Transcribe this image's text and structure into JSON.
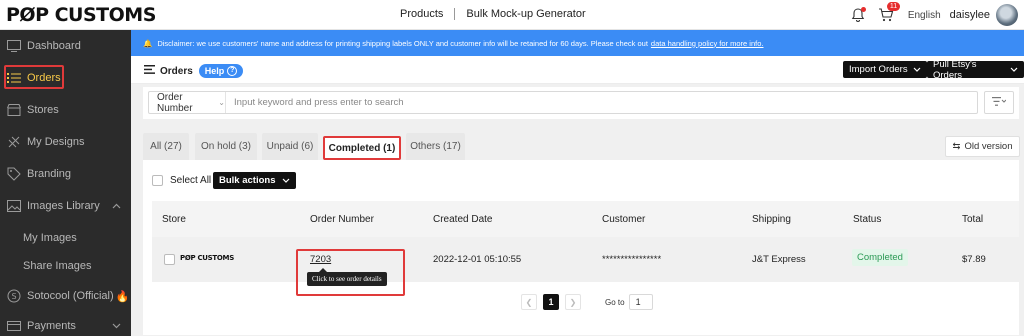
{
  "header": {
    "logo": "PØP CUSTOMS",
    "nav": [
      "Products",
      "Bulk Mock-up Generator"
    ],
    "cart_count": "11",
    "language": "English",
    "username": "daisylee"
  },
  "sidebar": {
    "items": [
      {
        "label": "Dashboard",
        "icon": "dashboard-icon"
      },
      {
        "label": "Orders",
        "icon": "orders-list-icon",
        "active": true
      },
      {
        "label": "Stores",
        "icon": "store-icon"
      },
      {
        "label": "My Designs",
        "icon": "design-icon"
      },
      {
        "label": "Branding",
        "icon": "tag-icon"
      },
      {
        "label": "Images Library",
        "icon": "image-icon"
      },
      {
        "label": "My Images"
      },
      {
        "label": "Share Images"
      },
      {
        "label": "Sotocool (Official)",
        "icon": "coin-icon"
      },
      {
        "label": "Payments",
        "icon": "payment-icon"
      }
    ]
  },
  "banner": {
    "text": "Disclaimer: we use customers' name and address for printing shipping labels ONLY and customer info will be retained for 60 days. Please check out",
    "link": "data handling policy for more info."
  },
  "orders_header": {
    "title": "Orders",
    "help": "Help",
    "import_button": "Import Orders",
    "pull_button": "Pull Etsy's Orders"
  },
  "search": {
    "field_select": "Order Number",
    "placeholder": "Input keyword and press enter to search"
  },
  "tabs": [
    {
      "label": "All (27)"
    },
    {
      "label": "On hold (3)"
    },
    {
      "label": "Unpaid (6)"
    },
    {
      "label": "Completed (1)",
      "active": true
    },
    {
      "label": "Others (17)"
    }
  ],
  "old_version": "Old version",
  "toolbar": {
    "select_all": "Select All",
    "bulk_actions": "Bulk actions"
  },
  "table": {
    "columns": [
      "Store",
      "Order Number",
      "Created Date",
      "Customer",
      "Shipping",
      "Status",
      "Total"
    ],
    "rows": [
      {
        "store": "PØP CUSTOMS",
        "order_number": "7203",
        "created_date": "2022-12-01 05:10:55",
        "customer": "****************",
        "shipping": "J&T Express",
        "status": "Completed",
        "total": "$7.89"
      }
    ]
  },
  "tooltip": "Click to see order details",
  "pagination": {
    "current": "1",
    "goto_label": "Go to",
    "goto_value": "1"
  },
  "colors": {
    "accent_blue": "#3b8cf5",
    "highlight_red": "#e03a3a",
    "active_yellow": "#f7c948",
    "sidebar_bg": "#2b2b2b",
    "status_green": "#2b9a55"
  }
}
